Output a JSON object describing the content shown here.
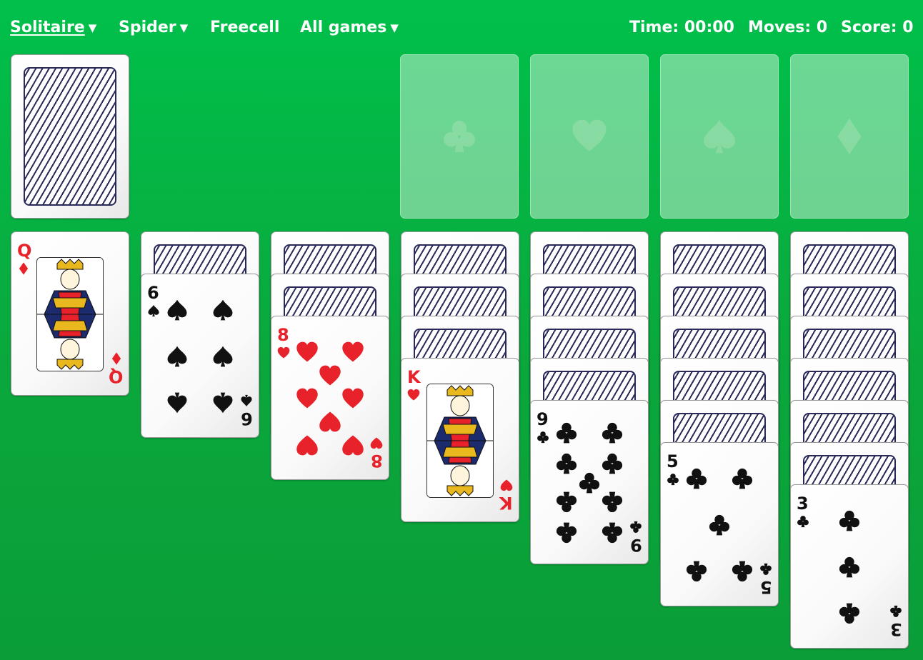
{
  "nav": {
    "solitaire": "Solitaire",
    "spider": "Spider",
    "freecell": "Freecell",
    "all_games": "All games",
    "caret_icon": "caret-down-icon"
  },
  "stats": {
    "time": "Time: 00:00",
    "moves": "Moves: 0",
    "score": "Score: 0"
  },
  "foundations": [
    "clubs",
    "hearts",
    "spades",
    "diamonds"
  ],
  "tableau": [
    {
      "face_down": 0,
      "top": {
        "rank": "Q",
        "suit": "diamonds"
      }
    },
    {
      "face_down": 1,
      "top": {
        "rank": "6",
        "suit": "spades"
      }
    },
    {
      "face_down": 2,
      "top": {
        "rank": "8",
        "suit": "hearts"
      }
    },
    {
      "face_down": 3,
      "top": {
        "rank": "K",
        "suit": "hearts"
      }
    },
    {
      "face_down": 4,
      "top": {
        "rank": "9",
        "suit": "clubs"
      }
    },
    {
      "face_down": 5,
      "top": {
        "rank": "5",
        "suit": "clubs"
      }
    },
    {
      "face_down": 6,
      "top": {
        "rank": "3",
        "suit": "clubs"
      }
    }
  ],
  "colors": {
    "felt": "#00c04b",
    "card_back_stripe": "#2a2a5a",
    "red_suit": "#e8222a",
    "black_suit": "#111111"
  }
}
